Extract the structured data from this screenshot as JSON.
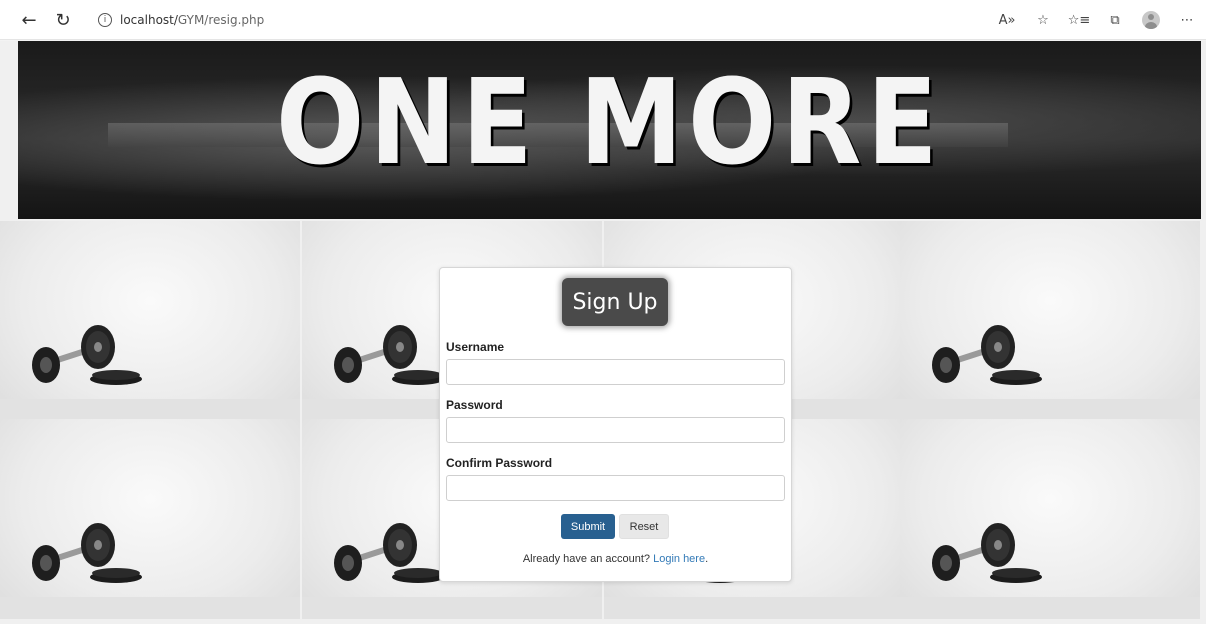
{
  "browser": {
    "url_host": "localhost/",
    "url_path": "GYM/resig.php",
    "back_glyph": "←",
    "reload_glyph": "↻",
    "info_glyph": "i",
    "tools": {
      "read_aloud": "A»",
      "favorite": "☆",
      "favorites_list": "☆≡",
      "collections": "⧉",
      "more": "⋯"
    }
  },
  "hero": {
    "title": "ONE MORE"
  },
  "signup": {
    "heading": "Sign Up",
    "username_label": "Username",
    "username_value": "",
    "password_label": "Password",
    "password_value": "",
    "confirm_label": "Confirm Password",
    "confirm_value": "",
    "submit_label": "Submit",
    "reset_label": "Reset",
    "footer_prefix": "Already have an account?",
    "login_link": "Login here",
    "footer_suffix": "."
  },
  "colors": {
    "submit_bg": "#286090",
    "link": "#337ab7",
    "badge_bg": "#4a4a4a"
  }
}
